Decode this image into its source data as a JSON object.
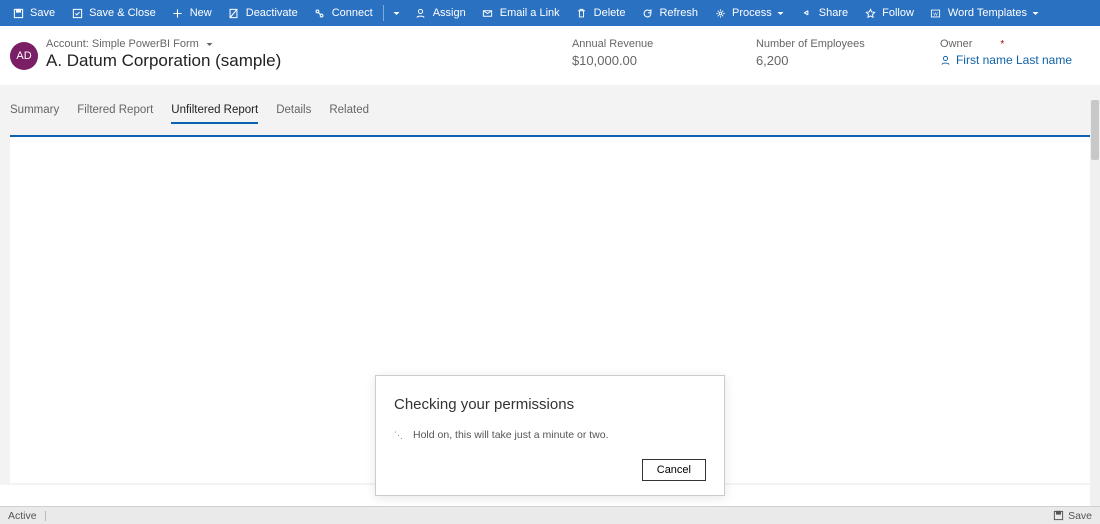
{
  "ribbon": {
    "save": "Save",
    "save_close": "Save & Close",
    "new": "New",
    "deactivate": "Deactivate",
    "connect": "Connect",
    "assign": "Assign",
    "email_link": "Email a Link",
    "delete": "Delete",
    "refresh": "Refresh",
    "process": "Process",
    "share": "Share",
    "follow": "Follow",
    "word_templates": "Word Templates"
  },
  "header": {
    "avatar_initials": "AD",
    "form_label": "Account: Simple PowerBI Form",
    "entity_name": "A. Datum Corporation (sample)",
    "fields": {
      "revenue_label": "Annual Revenue",
      "revenue_value": "$10,000.00",
      "employees_label": "Number of Employees",
      "employees_value": "6,200",
      "owner_label": "Owner",
      "owner_value": "First name Last name"
    }
  },
  "tabs": {
    "summary": "Summary",
    "filtered": "Filtered Report",
    "unfiltered": "Unfiltered Report",
    "details": "Details",
    "related": "Related"
  },
  "modal": {
    "title": "Checking your permissions",
    "body": "Hold on, this will take just a minute or two.",
    "cancel": "Cancel"
  },
  "footer": {
    "status": "Active",
    "save": "Save"
  }
}
